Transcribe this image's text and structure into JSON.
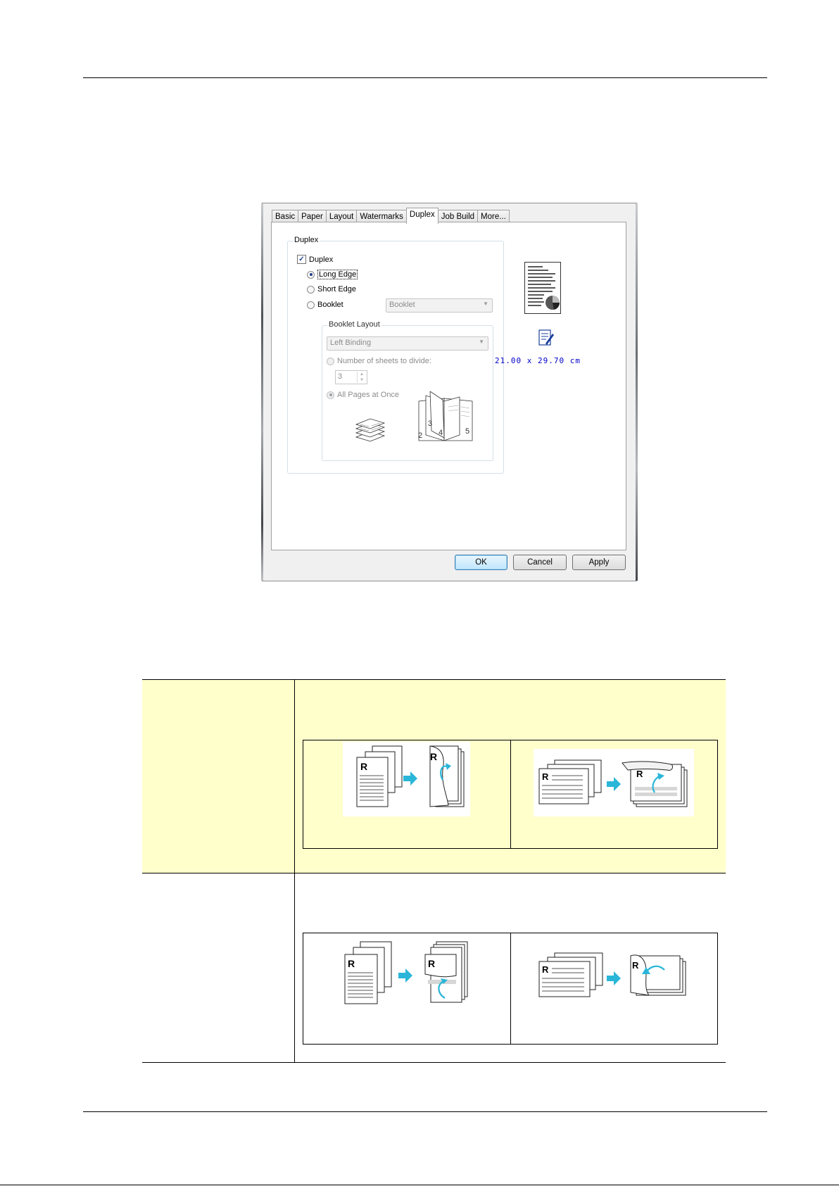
{
  "dialog": {
    "tabs": [
      "Basic",
      "Paper",
      "Layout",
      "Watermarks",
      "Duplex",
      "Job Build",
      "More..."
    ],
    "active_tab": "Duplex",
    "duplex_group": {
      "title": "Duplex",
      "duplex_checkbox": {
        "label": "Duplex",
        "checked": true
      },
      "options": [
        {
          "label": "Long Edge",
          "selected": true
        },
        {
          "label": "Short Edge",
          "selected": false
        },
        {
          "label": "Booklet",
          "selected": false
        }
      ],
      "booklet_select": "Booklet"
    },
    "booklet_layout": {
      "title": "Booklet Layout",
      "binding_select": "Left Binding",
      "sheets_option": "Number of sheets to divide:",
      "sheets_value": "3",
      "all_pages_option": "All Pages at Once",
      "page_numbers": [
        "2",
        "3",
        "4",
        "5"
      ]
    },
    "paper_size": "21.00 x 29.70 cm",
    "buttons": {
      "ok": "OK",
      "cancel": "Cancel",
      "apply": "Apply"
    }
  },
  "colors": {
    "highlight_row": "#ffffcc",
    "arrow": "#29b6d8",
    "link_blue": "#0000c8"
  },
  "icons": [
    "page-preview-icon",
    "paper-size-icon",
    "stacked-sheets-icon",
    "booklet-icon",
    "duplex-illustration-icon"
  ]
}
